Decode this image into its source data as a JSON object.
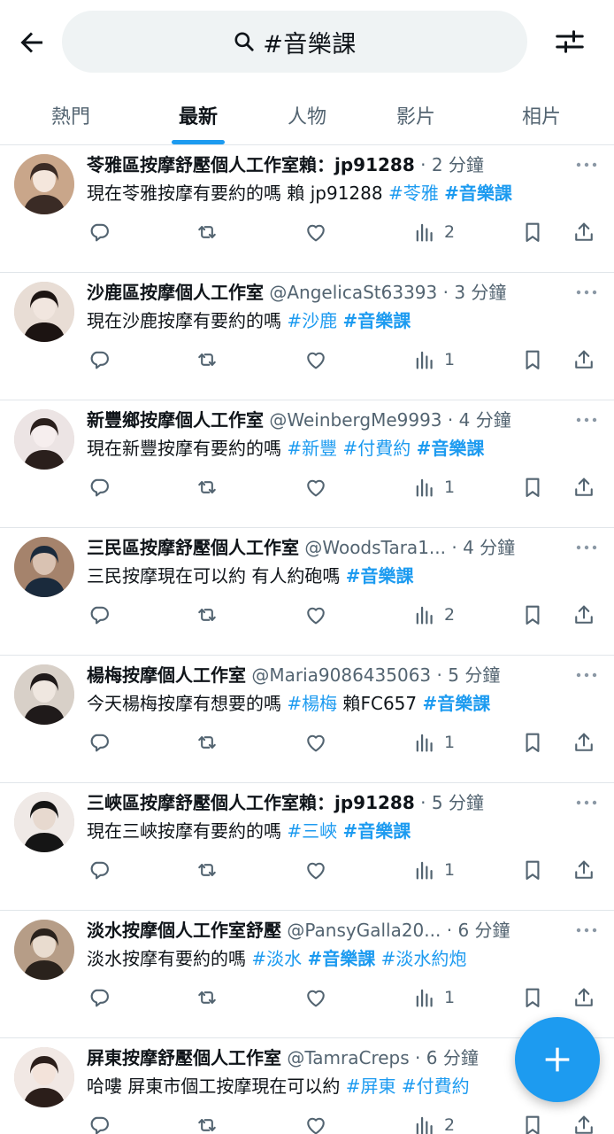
{
  "header": {
    "search_query": "#音樂課",
    "back_icon": "arrow-left-icon",
    "filter_icon": "sliders-icon"
  },
  "tabs": [
    {
      "label": "熱門",
      "active": false
    },
    {
      "label": "最新",
      "active": true
    },
    {
      "label": "人物",
      "active": false
    },
    {
      "label": "影片",
      "active": false
    },
    {
      "label": "相片",
      "active": false
    }
  ],
  "tweets": [
    {
      "name": "苓雅區按摩舒壓個人工作室賴：jp91288",
      "handle": "",
      "time": "2 分鐘",
      "text": "現在苓雅按摩有要約的嗎 賴 jp91288 ",
      "tags": [
        "#苓雅"
      ],
      "bold_tag": "#音樂課",
      "after": "",
      "views": "2"
    },
    {
      "name": "沙鹿區按摩個人工作室",
      "handle": "@AngelicaSt63393",
      "time": "3 分鐘",
      "text": "現在沙鹿按摩有要約的嗎  ",
      "tags": [
        "#沙鹿"
      ],
      "bold_tag": "#音樂課",
      "after": "",
      "views": "1"
    },
    {
      "name": "新豐鄉按摩個人工作室",
      "handle": "@WeinbergMe9993",
      "time": "4 分鐘",
      "text": "現在新豐按摩有要約的嗎 ",
      "tags": [
        "#新豐",
        "#付費約"
      ],
      "bold_tag": "#音樂課",
      "after": "",
      "views": "1"
    },
    {
      "name": "三民區按摩舒壓個人工作室",
      "handle": "@WoodsTara1...",
      "time": "4 分鐘",
      "text": "三民按摩現在可以約 有人約砲嗎 ",
      "tags": [],
      "bold_tag": "#音樂課",
      "after": "",
      "views": "2"
    },
    {
      "name": "楊梅按摩個人工作室",
      "handle": "@Maria9086435063",
      "time": "5 分鐘",
      "text": "今天楊梅按摩有想要的嗎   ",
      "tags": [
        "#楊梅"
      ],
      "mid_text": "  賴FC657 ",
      "bold_tag": "#音樂課",
      "after": "",
      "views": "1"
    },
    {
      "name": "三峽區按摩舒壓個人工作室賴：jp91288",
      "handle": "",
      "time": "5 分鐘",
      "text": "現在三峽按摩有要約的嗎 ",
      "tags": [
        "#三峽"
      ],
      "bold_tag": "#音樂課",
      "after": "",
      "views": "1"
    },
    {
      "name": "淡水按摩個人工作室舒壓",
      "handle": "@PansyGalla20...",
      "time": "6 分鐘",
      "text": "淡水按摩有要約的嗎 ",
      "tags": [
        "#淡水"
      ],
      "bold_tag": "#音樂課",
      "after": "#淡水約炮",
      "views": "1"
    },
    {
      "name": "屏東按摩舒壓個人工作室",
      "handle": "@TamraCreps",
      "time": "6 分鐘",
      "text": "哈嘍 屏東市個工按摩現在可以約 ",
      "tags": [
        "#屏東",
        "#付費約"
      ],
      "bold_tag": "",
      "after": "",
      "views": "2"
    }
  ],
  "actions": {
    "reply_icon": "reply-icon",
    "retweet_icon": "retweet-icon",
    "like_icon": "heart-icon",
    "views_icon": "views-chart-icon",
    "bookmark_icon": "bookmark-icon",
    "share_icon": "share-icon"
  },
  "fab": {
    "icon": "plus-icon"
  },
  "colors": {
    "accent": "#1d9bf0",
    "text": "#0f1419",
    "muted": "#536471"
  }
}
